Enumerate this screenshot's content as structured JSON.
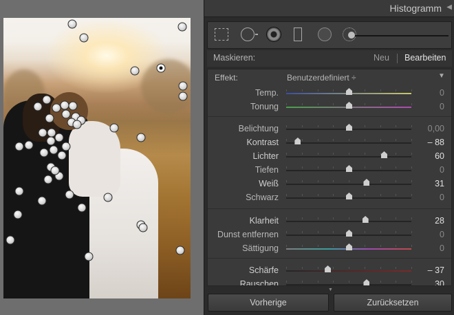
{
  "panel": {
    "title": "Histogramm",
    "collapse_glyph": "◀"
  },
  "mask": {
    "label": "Maskieren:",
    "new_label": "Neu",
    "edit_label": "Bearbeiten"
  },
  "effect": {
    "label": "Effekt:",
    "value": "Benutzerdefiniert ÷",
    "caret": "▼"
  },
  "sliders": [
    {
      "label": "Temp.",
      "value": "0",
      "pos": 0.5,
      "track": "temp"
    },
    {
      "label": "Tonung",
      "value": "0",
      "pos": 0.5,
      "track": "tint"
    },
    {
      "label": "Belichtung",
      "value": "0,00",
      "pos": 0.5
    },
    {
      "label": "Kontrast",
      "value": "– 88",
      "pos": 0.09
    },
    {
      "label": "Lichter",
      "value": "60",
      "pos": 0.78
    },
    {
      "label": "Tiefen",
      "value": "0",
      "pos": 0.5
    },
    {
      "label": "Weiß",
      "value": "31",
      "pos": 0.64
    },
    {
      "label": "Schwarz",
      "value": "0",
      "pos": 0.5
    },
    {
      "label": "Klarheit",
      "value": "28",
      "pos": 0.63
    },
    {
      "label": "Dunst entfernen",
      "value": "0",
      "pos": 0.5
    },
    {
      "label": "Sättigung",
      "value": "0",
      "pos": 0.5,
      "track": "sat"
    },
    {
      "label": "Schärfe",
      "value": "– 37",
      "pos": 0.33,
      "track": "sharp"
    },
    {
      "label": "Rauschen",
      "value": "30",
      "pos": 0.64
    }
  ],
  "buttons": {
    "previous": "Vorherige",
    "reset": "Zurücksetzen"
  },
  "colors": {
    "panel_bg": "#3a3a3a",
    "text": "#b8b8b8",
    "highlight_text": "#e0e0e0"
  }
}
